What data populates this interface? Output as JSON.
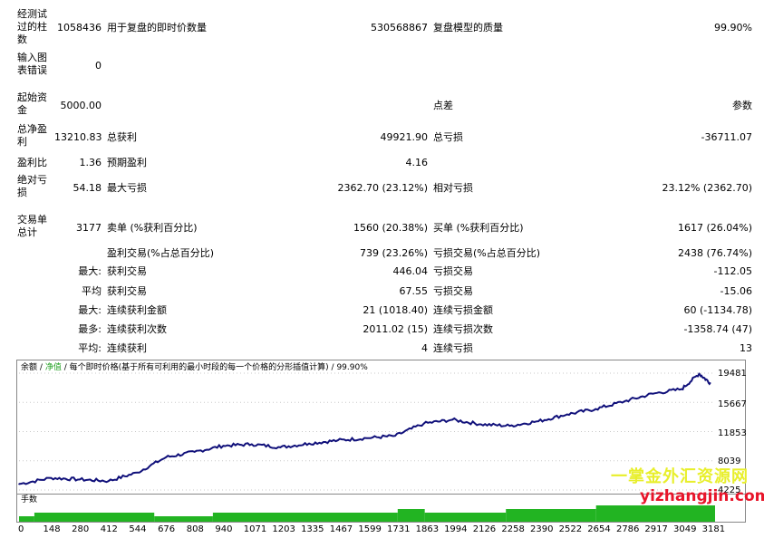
{
  "report": {
    "bars_label": "经测试过的柱数",
    "bars_value": "1058436",
    "ticks_label": "用于复盘的即时价数量",
    "ticks_value": "530568867",
    "quality_label": "复盘模型的质量",
    "quality_value": "99.90%",
    "mismatch_label": "输入图表错误",
    "mismatch_value": "0",
    "deposit_label": "起始资金",
    "deposit_value": "5000.00",
    "spread_label": "点差",
    "spread_value": "参数",
    "net_label": "总净盈利",
    "net_value": "13210.83",
    "gross_profit_label": "总获利",
    "gross_profit_value": "49921.90",
    "gross_loss_label": "总亏损",
    "gross_loss_value": "-36711.07",
    "pf_label": "盈利比",
    "pf_value": "1.36",
    "expected_label": "预期盈利",
    "expected_value": "4.16",
    "abs_dd_label": "绝对亏损",
    "abs_dd_value": "54.18",
    "max_dd_label": "最大亏损",
    "max_dd_value": "2362.70 (23.12%)",
    "rel_dd_label": "相对亏损",
    "rel_dd_value": "23.12% (2362.70)",
    "trades_label": "交易单总计",
    "trades_value": "3177",
    "short_label": "卖单 (%获利百分比)",
    "short_value": "1560 (20.38%)",
    "long_label": "买单 (%获利百分比)",
    "long_value": "1617 (26.04%)",
    "profit_trades_label": "盈利交易(%占总百分比)",
    "profit_trades_value": "739 (23.26%)",
    "loss_trades_label": "亏损交易(%占总百分比)",
    "loss_trades_value": "2438 (76.74%)",
    "largest_prefix": "最大:",
    "largest_profit_label": "获利交易",
    "largest_profit_value": "446.04",
    "largest_loss_label": "亏损交易",
    "largest_loss_value": "-112.05",
    "average_prefix": "平均",
    "avg_profit_label": "获利交易",
    "avg_profit_value": "67.55",
    "avg_loss_label": "亏损交易",
    "avg_loss_value": "-15.06",
    "maxcons_prefix": "最大:",
    "maxcons_wins_label": "连续获利金额",
    "maxcons_wins_value": "21 (1018.40)",
    "maxcons_losses_label": "连续亏损金额",
    "maxcons_losses_value": "60 (-1134.78)",
    "maxconsp_prefix": "最多:",
    "maxconsp_profit_label": "连续获利次数",
    "maxconsp_profit_value": "2011.02 (15)",
    "maxconsp_loss_label": "连续亏损次数",
    "maxconsp_loss_value": "-1358.74 (47)",
    "avgcons_prefix": "平均:",
    "avgcons_wins_label": "连续获利",
    "avgcons_wins_value": "4",
    "avgcons_losses_label": "连续亏损",
    "avgcons_losses_value": "13"
  },
  "chart": {
    "legend_balance": "余额",
    "legend_sep1": "/",
    "legend_equity": "净值",
    "legend_sep2": "/",
    "legend_model": "每个即时价格(基于所有可利用的最小时段的每一个价格的分形插值计算)",
    "legend_sep3": "/",
    "legend_quality": "99.90%",
    "volume_label": "手数",
    "line_color": "#10107a",
    "volume_color": "#22b422",
    "y_ticks": [
      "19481",
      "15667",
      "11853",
      "8039",
      "4225"
    ],
    "x_ticks": [
      "0",
      "148",
      "280",
      "412",
      "544",
      "676",
      "808",
      "940",
      "1071",
      "1203",
      "1335",
      "1467",
      "1599",
      "1731",
      "1863",
      "1994",
      "2126",
      "2258",
      "2390",
      "2522",
      "2654",
      "2786",
      "2917",
      "3049",
      "3181"
    ]
  },
  "watermark": {
    "line1": "一掌金外汇资源网",
    "line2": "yizhangjin.com"
  },
  "chart_data": {
    "type": "line",
    "title": "",
    "xlabel": "",
    "ylabel": "",
    "ylim": [
      4225,
      19481
    ],
    "x": [
      0,
      148,
      280,
      412,
      544,
      676,
      808,
      940,
      1071,
      1203,
      1335,
      1467,
      1599,
      1731,
      1863,
      1994,
      2126,
      2258,
      2390,
      2522,
      2654,
      2786,
      2917,
      3049,
      3130,
      3181
    ],
    "series": [
      {
        "values": [
          5000,
          5800,
          5600,
          5400,
          6500,
          8500,
          9200,
          10000,
          10200,
          9800,
          10300,
          10700,
          11000,
          11300,
          12900,
          13400,
          12800,
          12600,
          13200,
          14100,
          14800,
          15800,
          16800,
          17400,
          19400,
          18200
        ]
      }
    ],
    "volume_label": "手数"
  }
}
